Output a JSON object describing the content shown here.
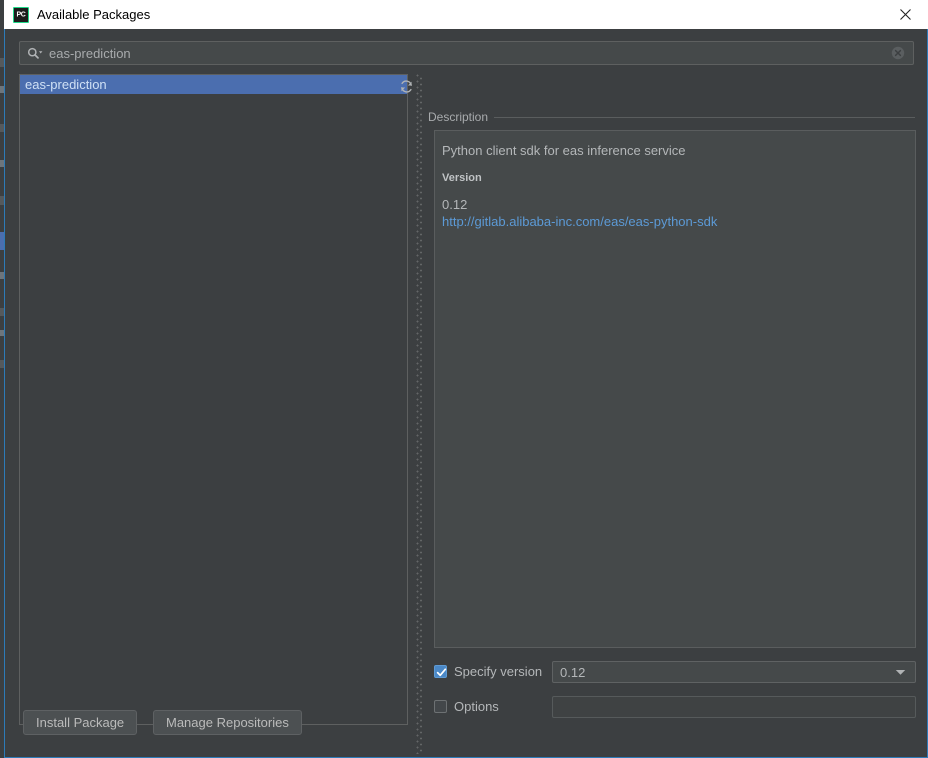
{
  "window": {
    "title": "Available Packages",
    "app_icon": "pycharm-icon",
    "app_icon_text": "PC",
    "close_icon": "close-icon",
    "focus_border_color": "#2d7bb8"
  },
  "search": {
    "icon": "search-icon",
    "value": "eas-prediction",
    "placeholder": "",
    "clear_icon": "clear-circle-icon"
  },
  "packages": {
    "refresh_icon": "refresh-icon",
    "items": [
      {
        "name": "eas-prediction",
        "selected": true
      }
    ]
  },
  "description": {
    "label": "Description",
    "summary": "Python client sdk for eas inference service",
    "version_label": "Version",
    "version_value": "0.12",
    "link": "http://gitlab.alibaba-inc.com/eas/eas-python-sdk",
    "link_color": "#5c9ad6"
  },
  "specify_version": {
    "label": "Specify version",
    "checked": true,
    "selected_value": "0.12",
    "options": [
      "0.12"
    ],
    "dropdown_icon": "chevron-down-icon",
    "accent_color": "#4a88c7"
  },
  "options": {
    "label": "Options",
    "checked": false,
    "value": "",
    "placeholder": ""
  },
  "footer": {
    "install_label": "Install Package",
    "manage_label": "Manage Repositories"
  }
}
